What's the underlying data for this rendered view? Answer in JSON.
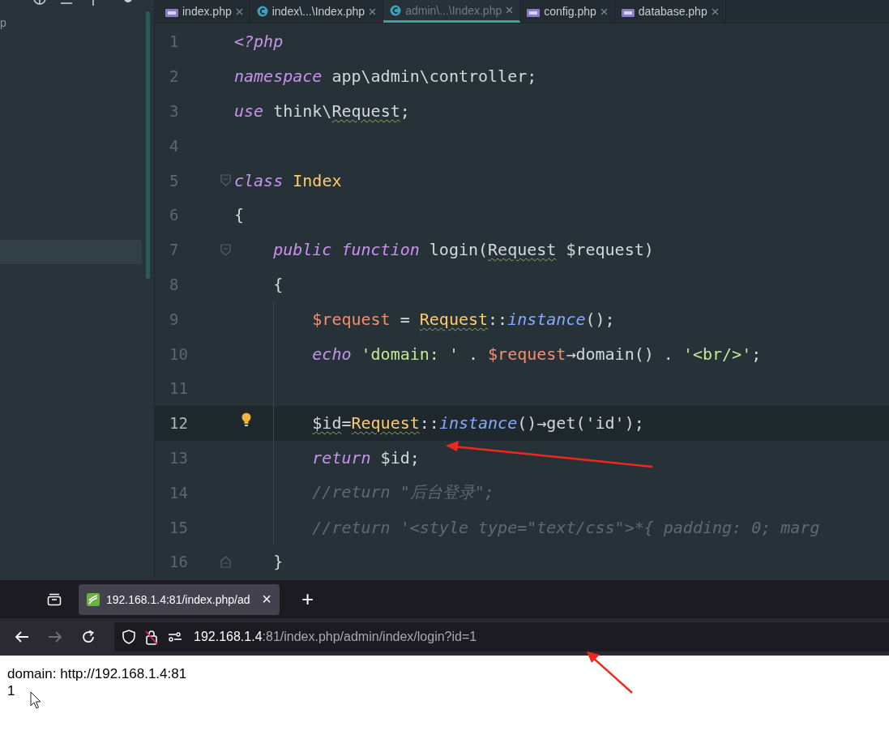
{
  "sidebar": {
    "item_text": "p",
    "rows": [
      {
        "selected": true
      }
    ]
  },
  "editor_tabs": [
    {
      "label": "index.php",
      "kind": "php",
      "selected": false
    },
    {
      "label": "index\\...\\Index.php",
      "kind": "class",
      "selected": false
    },
    {
      "label": "admin\\...\\Index.php",
      "kind": "class",
      "selected": true
    },
    {
      "label": "config.php",
      "kind": "php",
      "selected": false
    },
    {
      "label": "database.php",
      "kind": "php",
      "selected": false
    }
  ],
  "code_lines": [
    {
      "number": "1",
      "current": false,
      "tokens": [
        {
          "kind": "keyword",
          "text": "<?php"
        }
      ]
    },
    {
      "number": "2",
      "current": false,
      "tokens": [
        {
          "kind": "keyword",
          "text": "namespace"
        },
        {
          "kind": "plain",
          "text": " app\\admin\\controller;"
        }
      ]
    },
    {
      "number": "3",
      "current": false,
      "tokens": [
        {
          "kind": "keyword",
          "text": "use"
        },
        {
          "kind": "plain",
          "text": " think\\"
        },
        {
          "kind": "plain",
          "text": "Request",
          "warn": true
        },
        {
          "kind": "plain",
          "text": ";"
        }
      ]
    },
    {
      "number": "4",
      "current": false
    },
    {
      "number": "5",
      "current": false,
      "fold_start": true,
      "tokens": [
        {
          "kind": "keyword",
          "text": "class"
        },
        {
          "kind": "class",
          "text": " Index"
        }
      ]
    },
    {
      "number": "6",
      "current": false,
      "tokens": [
        {
          "kind": "plain",
          "text": "{"
        }
      ],
      "children": [
        {
          "number": "7",
          "current": false,
          "fold_start": true,
          "tokens": [
            {
              "kind": "keyword",
              "text": "public"
            },
            {
              "kind": "keyword",
              "text": " function"
            },
            {
              "kind": "plain",
              "text": " login("
            },
            {
              "kind": "plain",
              "text": "Request",
              "warn": true
            },
            {
              "kind": "plain",
              "text": " $request)"
            }
          ]
        },
        {
          "number": "8",
          "current": false,
          "tokens": [
            {
              "kind": "plain",
              "text": "{"
            }
          ],
          "children": [
            {
              "number": "9",
              "current": false,
              "tokens": [
                {
                  "kind": "variable",
                  "text": "$request"
                },
                {
                  "kind": "plain",
                  "text": " = "
                },
                {
                  "kind": "class",
                  "text": "Request",
                  "warn": true
                },
                {
                  "kind": "plain",
                  "text": "::"
                },
                {
                  "kind": "method",
                  "text": "instance"
                },
                {
                  "kind": "plain",
                  "text": "();"
                }
              ]
            },
            {
              "number": "10",
              "current": false,
              "tokens": [
                {
                  "kind": "keyword",
                  "text": "echo"
                },
                {
                  "kind": "string",
                  "text": " 'domain: '"
                },
                {
                  "kind": "plain",
                  "text": " . "
                },
                {
                  "kind": "variable",
                  "text": "$request"
                },
                {
                  "kind": "plain",
                  "text": "→domain() . "
                },
                {
                  "kind": "string",
                  "text": "'<br/>'"
                },
                {
                  "kind": "plain",
                  "text": ";"
                }
              ]
            },
            {
              "number": "11",
              "current": false
            },
            {
              "number": "12",
              "current": true,
              "tokens": [
                {
                  "kind": "plain",
                  "text": "$id",
                  "warn": true
                },
                {
                  "kind": "plain",
                  "text": "="
                },
                {
                  "kind": "class",
                  "text": "Request",
                  "warn": true
                },
                {
                  "kind": "plain",
                  "text": "::"
                },
                {
                  "kind": "method",
                  "text": "instance"
                },
                {
                  "kind": "plain",
                  "text": "()→get('id');"
                }
              ]
            },
            {
              "number": "13",
              "current": false,
              "tokens": [
                {
                  "kind": "keyword",
                  "text": "return"
                },
                {
                  "kind": "plain",
                  "text": " $id;"
                }
              ]
            },
            {
              "number": "14",
              "current": false,
              "tokens": [
                {
                  "kind": "comment",
                  "text": "//return \"后台登录\";"
                }
              ]
            },
            {
              "number": "15",
              "current": false,
              "tokens": [
                {
                  "kind": "comment",
                  "text": "//return '<style type=\"text/css\">*{ padding: 0; marg"
                }
              ]
            }
          ]
        },
        {
          "number": "16",
          "current": false,
          "fold_end": true,
          "tokens": [
            {
              "kind": "plain",
              "text": "}"
            }
          ]
        }
      ]
    }
  ],
  "browser": {
    "tab": {
      "title": "192.168.1.4:81/index.php/ad",
      "close": "×",
      "selected": true
    },
    "new_tab": "+",
    "forward_disabled": true,
    "address": {
      "host": "192.168.1.4",
      "rest": ":81/index.php/admin/index/login?id=1"
    }
  },
  "page": {
    "lines": [
      "domain: http://192.168.1.4:81",
      "1"
    ]
  }
}
